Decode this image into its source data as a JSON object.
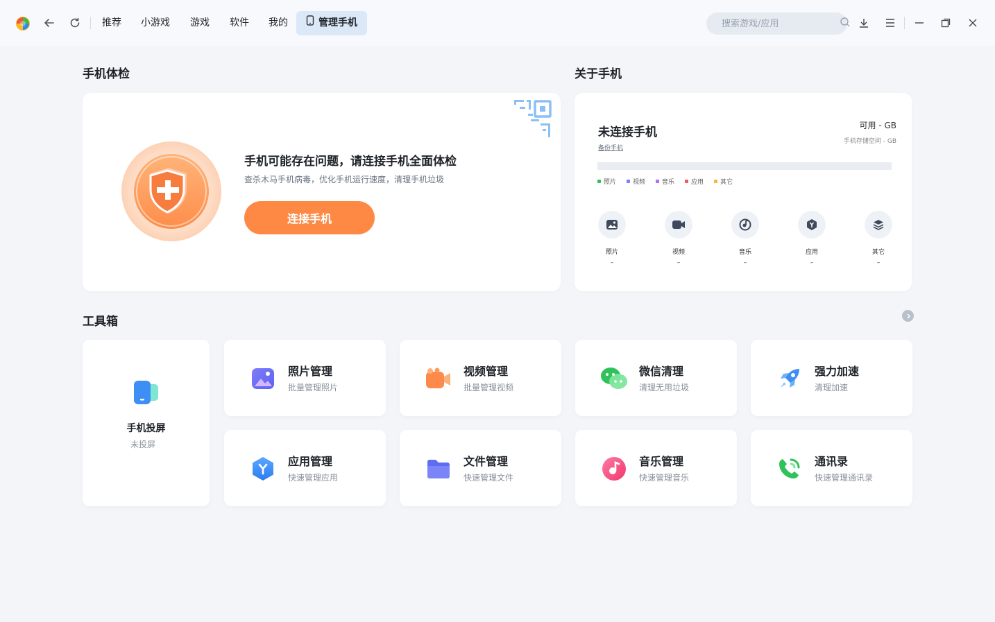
{
  "nav": {
    "tabs": [
      "推荐",
      "小游戏",
      "游戏",
      "软件",
      "我的"
    ],
    "active_tab": "管理手机",
    "search_placeholder": "搜索游戏/应用"
  },
  "health": {
    "section_title": "手机体检",
    "headline": "手机可能存在问题，请连接手机全面体检",
    "subline": "查杀木马手机病毒，优化手机运行速度，清理手机垃圾",
    "button": "连接手机"
  },
  "about": {
    "section_title": "关于手机",
    "status": "未连接手机",
    "backup_link": "备份手机",
    "available": "可用 - GB",
    "storage": "手机存储空间 - GB",
    "legend": [
      {
        "label": "照片",
        "color": "#2fc25b"
      },
      {
        "label": "视频",
        "color": "#7b7ff7"
      },
      {
        "label": "音乐",
        "color": "#b36cf2"
      },
      {
        "label": "应用",
        "color": "#f05a5a"
      },
      {
        "label": "其它",
        "color": "#f7b53b"
      }
    ],
    "categories": [
      {
        "label": "照片",
        "value": "–",
        "icon": "photo-icon"
      },
      {
        "label": "视频",
        "value": "–",
        "icon": "video-icon"
      },
      {
        "label": "音乐",
        "value": "–",
        "icon": "music-icon"
      },
      {
        "label": "应用",
        "value": "–",
        "icon": "app-icon"
      },
      {
        "label": "其它",
        "value": "–",
        "icon": "layers-icon"
      }
    ]
  },
  "toolbox": {
    "section_title": "工具箱",
    "cast": {
      "title": "手机投屏",
      "subtitle": "未投屏"
    },
    "tools": [
      {
        "title": "照片管理",
        "subtitle": "批量管理照片",
        "icon": "photo-manage-icon"
      },
      {
        "title": "视频管理",
        "subtitle": "批量管理视频",
        "icon": "video-manage-icon"
      },
      {
        "title": "微信清理",
        "subtitle": "清理无用垃圾",
        "icon": "wechat-icon"
      },
      {
        "title": "强力加速",
        "subtitle": "清理加速",
        "icon": "rocket-icon"
      },
      {
        "title": "应用管理",
        "subtitle": "快速管理应用",
        "icon": "app-manage-icon"
      },
      {
        "title": "文件管理",
        "subtitle": "快速管理文件",
        "icon": "folder-icon"
      },
      {
        "title": "音乐管理",
        "subtitle": "快速管理音乐",
        "icon": "music-manage-icon"
      },
      {
        "title": "通讯录",
        "subtitle": "快速管理通讯录",
        "icon": "contacts-icon"
      }
    ]
  }
}
